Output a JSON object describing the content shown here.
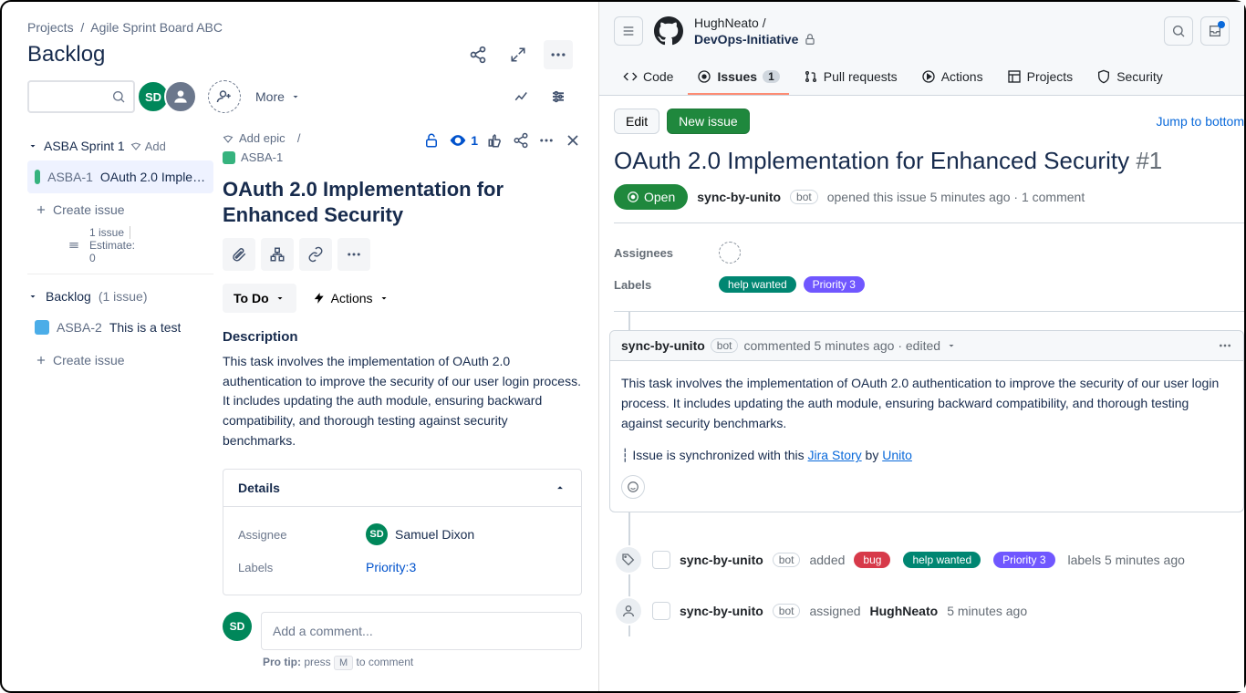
{
  "jira": {
    "breadcrumb": {
      "projects": "Projects",
      "board": "Agile Sprint Board ABC"
    },
    "page_title": "Backlog",
    "more_label": "More",
    "sprint": {
      "name": "ASBA Sprint 1",
      "add_label": "Add",
      "issues": [
        {
          "key": "ASBA-1",
          "summary": "OAuth 2.0 Implementation for Enhanced Security"
        }
      ],
      "issue_count_text": "1 issue",
      "estimate_label": "Estimate:",
      "estimate_value": "0"
    },
    "create_issue_label": "Create issue",
    "backlog": {
      "title": "Backlog",
      "count_text": "(1 issue)",
      "issues": [
        {
          "key": "ASBA-2",
          "summary": "This is a test"
        }
      ]
    },
    "detail": {
      "add_epic": "Add epic",
      "key": "ASBA-1",
      "watch_count": "1",
      "title": "OAuth 2.0 Implementation for Enhanced Security",
      "status": "To Do",
      "actions_label": "Actions",
      "description_label": "Description",
      "description": "This task involves the implementation of OAuth 2.0 authentication to improve the security of our user login process. It includes updating the auth module, ensuring backward compatibility, and thorough testing against security benchmarks.",
      "details_label": "Details",
      "assignee_label": "Assignee",
      "assignee_initials": "SD",
      "assignee_name": "Samuel Dixon",
      "labels_label": "Labels",
      "labels_value": "Priority:3",
      "comment_placeholder": "Add a comment...",
      "protip_prefix": "Pro tip:",
      "protip_text": " press ",
      "protip_key": "M",
      "protip_suffix": " to comment"
    },
    "user_initials": "SD"
  },
  "github": {
    "owner": "HughNeato",
    "repo": "DevOps-Initiative",
    "tabs": {
      "code": "Code",
      "issues": "Issues",
      "issues_count": "1",
      "pulls": "Pull requests",
      "actions": "Actions",
      "projects": "Projects",
      "security": "Security"
    },
    "edit_btn": "Edit",
    "new_issue_btn": "New issue",
    "jump_link": "Jump to bottom",
    "issue": {
      "title": "OAuth 2.0 Implementation for Enhanced Security",
      "number": "#1",
      "state": "Open",
      "author": "sync-by-unito",
      "bot_badge": "bot",
      "opened_text": "opened this issue 5 minutes ago · 1 comment",
      "assignees_label": "Assignees",
      "labels_label": "Labels",
      "labels": [
        {
          "text": "help wanted",
          "class": "pill-green"
        },
        {
          "text": "Priority 3",
          "class": "pill-purple"
        }
      ]
    },
    "comment": {
      "author": "sync-by-unito",
      "meta": "commented 5 minutes ago · edited",
      "body": "This task involves the implementation of OAuth 2.0 authentication to improve the security of our user login process. It includes updating the auth module, ensuring backward compatibility, and thorough testing against security benchmarks.",
      "sync_prefix": "Issue is synchronized with this ",
      "sync_link1": "Jira Story",
      "sync_mid": " by ",
      "sync_link2": "Unito"
    },
    "events": {
      "label_event": {
        "author": "sync-by-unito",
        "action": "added",
        "labels": [
          {
            "text": "bug",
            "class": "pill-red"
          },
          {
            "text": "help wanted",
            "class": "pill-green"
          },
          {
            "text": "Priority 3",
            "class": "pill-purple"
          }
        ],
        "suffix": "labels 5 minutes ago"
      },
      "assign_event": {
        "author": "sync-by-unito",
        "action": "assigned",
        "target": "HughNeato",
        "time": "5 minutes ago"
      }
    }
  }
}
